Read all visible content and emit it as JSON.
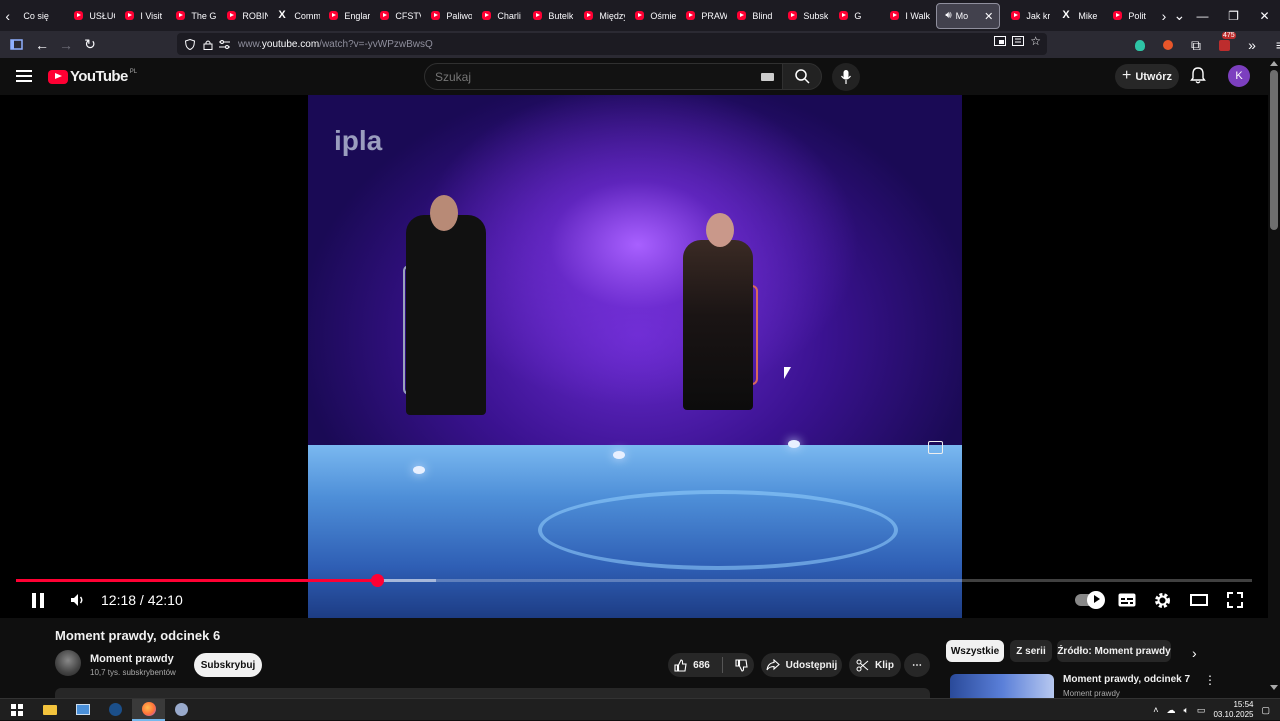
{
  "browser": {
    "tabs": [
      {
        "label": "Co się",
        "favicon": "none"
      },
      {
        "label": "USŁUG",
        "favicon": "youtube-icon"
      },
      {
        "label": "I Visit",
        "favicon": "youtube-icon"
      },
      {
        "label": "The G",
        "favicon": "youtube-icon"
      },
      {
        "label": "ROBIN",
        "favicon": "youtube-icon"
      },
      {
        "label": "Comm",
        "favicon": "x-icon"
      },
      {
        "label": "Englar",
        "favicon": "youtube-icon"
      },
      {
        "label": "CFSTV",
        "favicon": "youtube-icon"
      },
      {
        "label": "Paliwo",
        "favicon": "youtube-icon"
      },
      {
        "label": "Charli",
        "favicon": "youtube-icon"
      },
      {
        "label": "Butelk",
        "favicon": "youtube-icon"
      },
      {
        "label": "Między",
        "favicon": "youtube-icon"
      },
      {
        "label": "Ośmie",
        "favicon": "youtube-icon"
      },
      {
        "label": "PRAW",
        "favicon": "youtube-icon"
      },
      {
        "label": "Blind",
        "favicon": "youtube-icon"
      },
      {
        "label": "Subsk",
        "favicon": "youtube-icon"
      },
      {
        "label": "G",
        "favicon": "youtube-icon"
      },
      {
        "label": "I Walk",
        "favicon": "youtube-icon"
      }
    ],
    "active_tab": {
      "label": "Mo",
      "favicon": "youtube-icon"
    },
    "tabs_after": [
      {
        "label": "Jak kr",
        "favicon": "youtube-icon"
      },
      {
        "label": "Mike",
        "favicon": "x-icon"
      },
      {
        "label": "Polit",
        "favicon": "youtube-icon"
      }
    ],
    "url_prefix": "www.",
    "url_domain": "youtube.com",
    "url_path": "/watch?v=-yvWPzwBwsQ",
    "extension_badge": "475"
  },
  "youtube": {
    "logo_text": "YouTube",
    "country_code": "PL",
    "search_placeholder": "Szukaj",
    "create_label": "Utwórz",
    "avatar_letter": "K"
  },
  "player": {
    "watermark": "ipla",
    "current_time": "12:18",
    "duration": "42:10",
    "time_display": "12:18 / 42:10",
    "played_fraction": 0.292,
    "buffered_fraction": 0.34
  },
  "video": {
    "title": "Moment prawdy, odcinek 6",
    "channel_name": "Moment prawdy",
    "channel_subs": "10,7 tys. subskrybentów",
    "subscribe_label": "Subskrybuj",
    "likes": "686",
    "share_label": "Udostępnij",
    "clip_label": "Klip"
  },
  "sidebar": {
    "chips": [
      "Wszystkie",
      "Z serii",
      "Źródło: Moment prawdy"
    ],
    "related_title": "Moment prawdy, odcinek 7",
    "related_channel": "Moment prawdy"
  },
  "taskbar": {
    "time": "15:54",
    "date": "03.10.2025"
  },
  "colors": {
    "accent": "#ff0033",
    "background": "#0f0f0f",
    "chip_bg": "#272727"
  }
}
